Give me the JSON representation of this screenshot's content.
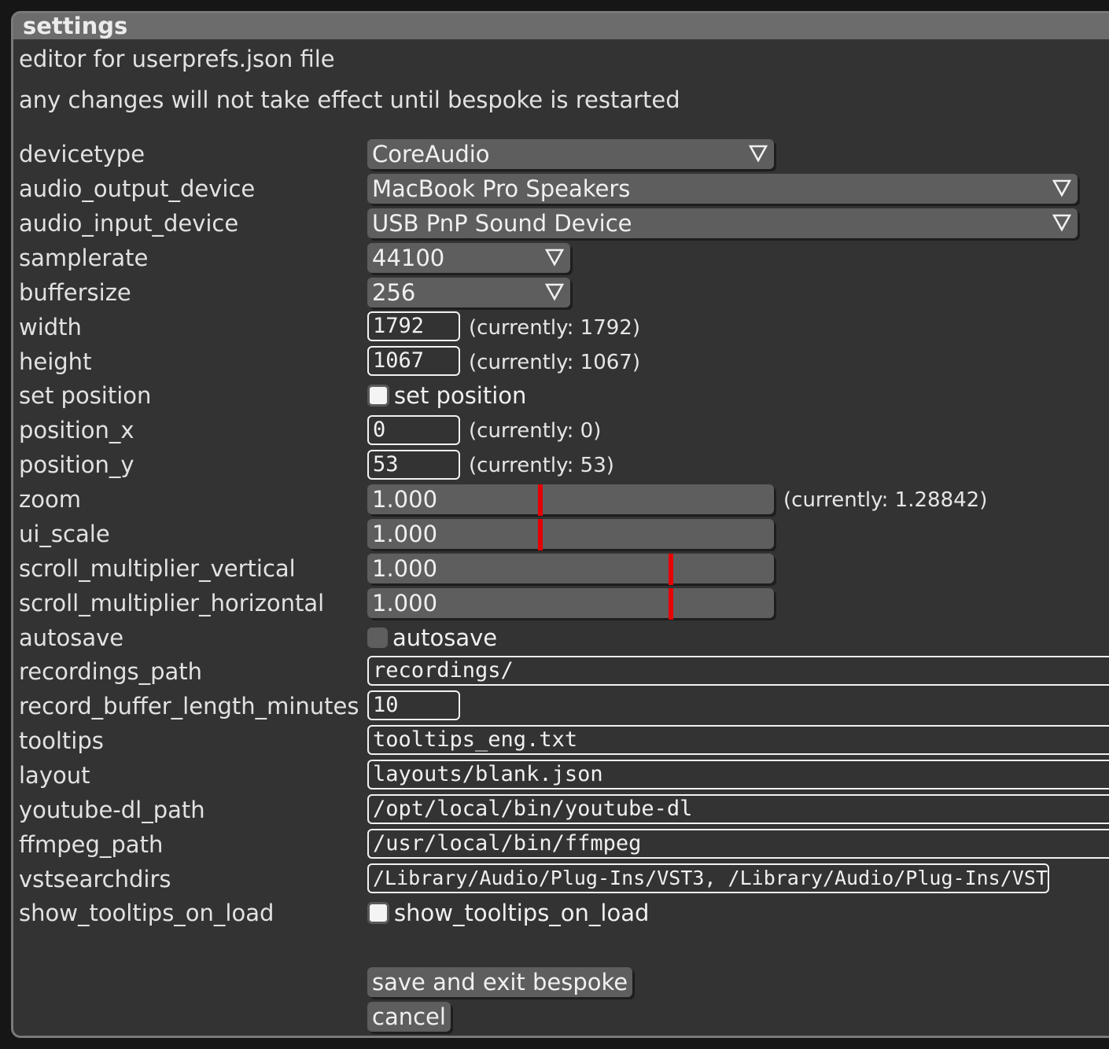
{
  "window": {
    "title": "settings"
  },
  "info": {
    "line1": "editor for userprefs.json file",
    "line2": "any changes will not take effect until bespoke is restarted"
  },
  "fields": {
    "devicetype": {
      "label": "devicetype",
      "value": "CoreAudio"
    },
    "audio_output_device": {
      "label": "audio_output_device",
      "value": "MacBook Pro Speakers"
    },
    "audio_input_device": {
      "label": "audio_input_device",
      "value": "USB PnP Sound Device"
    },
    "samplerate": {
      "label": "samplerate",
      "value": "44100"
    },
    "buffersize": {
      "label": "buffersize",
      "value": "256"
    },
    "width": {
      "label": "width",
      "value": "1792",
      "current": "(currently: 1792)"
    },
    "height": {
      "label": "height",
      "value": "1067",
      "current": "(currently: 1067)"
    },
    "set_position": {
      "label": "set position",
      "checkbox_label": "set position",
      "checked": false
    },
    "position_x": {
      "label": "position_x",
      "value": "0",
      "current": "(currently: 0)"
    },
    "position_y": {
      "label": "position_y",
      "value": "53",
      "current": "(currently: 53)"
    },
    "zoom": {
      "label": "zoom",
      "value": "1.000",
      "current": "(currently: 1.28842)",
      "fraction": 0.42
    },
    "ui_scale": {
      "label": "ui_scale",
      "value": "1.000",
      "fraction": 0.42
    },
    "scroll_multiplier_vertical": {
      "label": "scroll_multiplier_vertical",
      "value": "1.000",
      "fraction": 0.74
    },
    "scroll_multiplier_horizontal": {
      "label": "scroll_multiplier_horizontal",
      "value": "1.000",
      "fraction": 0.74
    },
    "autosave": {
      "label": "autosave",
      "checkbox_label": "autosave",
      "checked": false
    },
    "recordings_path": {
      "label": "recordings_path",
      "value": "recordings/"
    },
    "record_buffer_length_minutes": {
      "label": "record_buffer_length_minutes",
      "value": "10"
    },
    "tooltips": {
      "label": "tooltips",
      "value": "tooltips_eng.txt"
    },
    "layout": {
      "label": "layout",
      "value": "layouts/blank.json"
    },
    "youtube_dl_path": {
      "label": "youtube-dl_path",
      "value": "/opt/local/bin/youtube-dl"
    },
    "ffmpeg_path": {
      "label": "ffmpeg_path",
      "value": "/usr/local/bin/ffmpeg"
    },
    "vstsearchdirs": {
      "label": "vstsearchdirs",
      "value": "/Library/Audio/Plug-Ins/VST3, /Library/Audio/Plug-Ins/VST"
    },
    "show_tooltips_on_load": {
      "label": "show_tooltips_on_load",
      "checkbox_label": "show_tooltips_on_load",
      "checked": true
    }
  },
  "buttons": {
    "save": "save and exit bespoke",
    "cancel": "cancel"
  },
  "colors": {
    "slider_marker": "#e60000",
    "panel_bg": "#333333",
    "control_bg": "#5e5e5e"
  }
}
